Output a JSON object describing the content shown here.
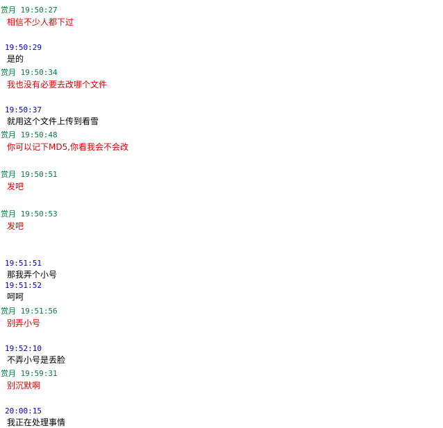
{
  "messages": [
    {
      "sender": "赏月",
      "time": "19:50:27",
      "text": "相信不少人都下过",
      "side": "other"
    },
    {
      "sender": "",
      "time": "19:50:29",
      "text": "是的",
      "side": "self"
    },
    {
      "sender": "赏月",
      "time": "19:50:34",
      "text": "我也没有必要去改哪个文件",
      "side": "other"
    },
    {
      "sender": "",
      "time": "19:50:37",
      "text": "就用这个文件上传到看雪",
      "side": "self"
    },
    {
      "sender": "赏月",
      "time": "19:50:48",
      "text": "你可以记下MD5,你看我会不会改",
      "side": "other"
    },
    {
      "sender": "赏月",
      "time": "19:50:51",
      "text": "发吧",
      "side": "other"
    },
    {
      "sender": "赏月",
      "time": "19:50:53",
      "text": "发吧",
      "side": "other"
    },
    {
      "sender": "",
      "time": "19:51:51",
      "text": "那我弄个小号",
      "side": "self"
    },
    {
      "sender": "",
      "time": "19:51:52",
      "text": "呵呵",
      "side": "self"
    },
    {
      "sender": "赏月",
      "time": "19:51:56",
      "text": "别弄小号",
      "side": "other"
    },
    {
      "sender": "",
      "time": "19:52:10",
      "text": "不弄小号是丢脸",
      "side": "self"
    },
    {
      "sender": "赏月",
      "time": "19:59:31",
      "text": "别沉默啊",
      "side": "other"
    },
    {
      "sender": "",
      "time": "20:00:15",
      "text": "我正在处理事情",
      "side": "self"
    }
  ],
  "colors": {
    "other_header": "#008040",
    "self_header": "#0000c0",
    "other_text": "#e00000",
    "self_text": "#000000"
  }
}
